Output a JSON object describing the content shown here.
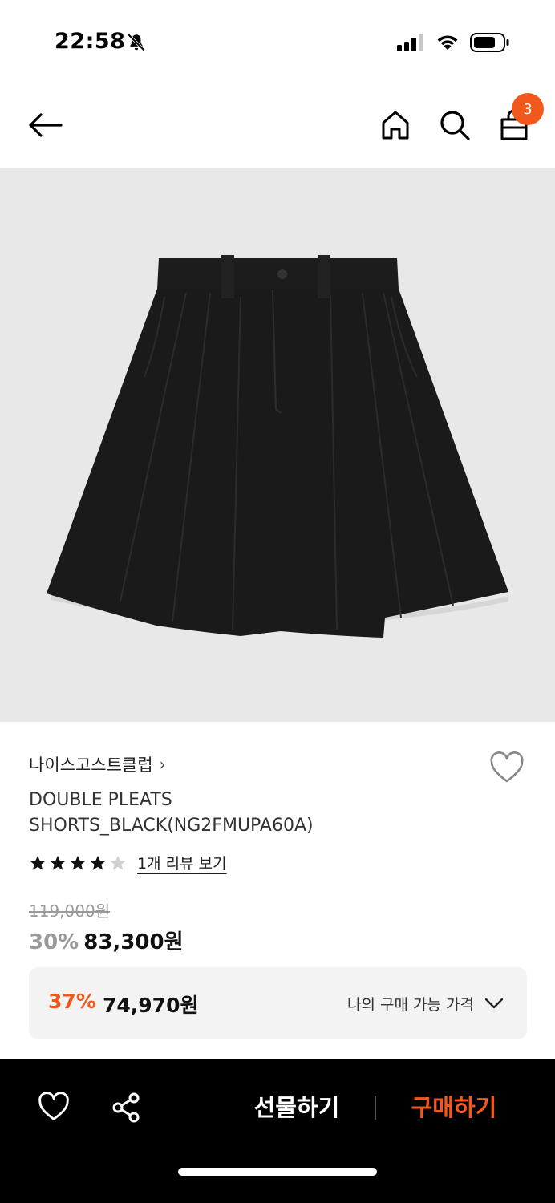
{
  "status_bar": {
    "time": "22:58",
    "icons": [
      "bell-slash-icon",
      "cellular-signal-icon",
      "wifi-icon",
      "battery-icon"
    ]
  },
  "header": {
    "icons": [
      "back-arrow-icon",
      "home-icon",
      "search-icon",
      "cart-icon"
    ],
    "cart_count": "3"
  },
  "product": {
    "image_alt_icon": "pleated-shorts-image",
    "brand": "나이스고스트클럽",
    "brand_chevron": "›",
    "name": "DOUBLE PLEATS SHORTS_BLACK(NG2FMUPA60A)",
    "rating": 4,
    "rating_max": 5,
    "review_link": "1개 리뷰 보기",
    "original_price": "119,000원",
    "discount_rate": "30%",
    "sale_price": "83,300원"
  },
  "member_price": {
    "rate": "37%",
    "price": "74,970원",
    "label": "나의 구매 가능 가격"
  },
  "bottom_bar": {
    "gift_label": "선물하기",
    "buy_label": "구매하기"
  },
  "colors": {
    "accent": "#f2581c",
    "image_bg": "#e8e8e8",
    "bottom_bar_bg": "#000000"
  }
}
